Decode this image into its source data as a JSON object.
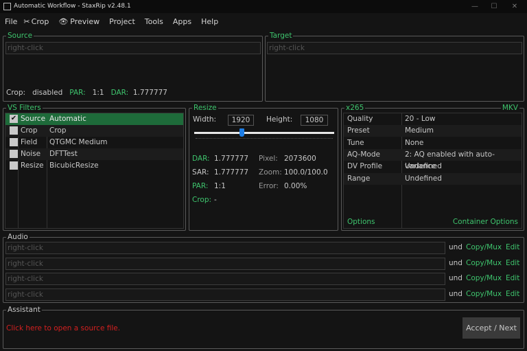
{
  "window": {
    "title": "Automatic Workflow - StaxRip v2.48.1",
    "controls": [
      "—",
      "☐",
      "✕"
    ]
  },
  "menu": {
    "file": "File",
    "crop": "Crop",
    "preview": "Preview",
    "project": "Project",
    "tools": "Tools",
    "apps": "Apps",
    "help": "Help"
  },
  "source": {
    "label": "Source",
    "placeholder": "right-click",
    "crop_label": "Crop:",
    "crop_value": "disabled",
    "par_label": "PAR:",
    "par_value": "1:1",
    "dar_label": "DAR:",
    "dar_value": "1.777777"
  },
  "target": {
    "label": "Target",
    "placeholder": "right-click"
  },
  "filters": {
    "label": "VS Filters",
    "items": [
      {
        "name": "Source",
        "value": "Automatic",
        "checked": true
      },
      {
        "name": "Crop",
        "value": "Crop",
        "checked": false
      },
      {
        "name": "Field",
        "value": "QTGMC Medium",
        "checked": false
      },
      {
        "name": "Noise",
        "value": "DFTTest",
        "checked": false
      },
      {
        "name": "Resize",
        "value": "BicubicResize",
        "checked": false
      }
    ]
  },
  "resize": {
    "label": "Resize",
    "width_label": "Width:",
    "width": "1920",
    "height_label": "Height:",
    "height": "1080",
    "slider_fraction": 0.34,
    "dar_label": "DAR:",
    "dar": "1.777777",
    "sar_label": "SAR:",
    "sar": "1.777777",
    "par_label": "PAR:",
    "par": "1:1",
    "crop_label": "Crop:",
    "crop": "-",
    "pixel_label": "Pixel:",
    "pixel": "2073600",
    "zoom_label": "Zoom:",
    "zoom": "100.0/100.0",
    "error_label": "Error:",
    "error": "0.00%"
  },
  "encoder": {
    "label": "x265",
    "container": "MKV",
    "rows": [
      {
        "k": "Quality",
        "v": "20 - Low"
      },
      {
        "k": "Preset",
        "v": "Medium"
      },
      {
        "k": "Tune",
        "v": "None"
      },
      {
        "k": "AQ-Mode",
        "v": "2: AQ enabled with auto-variance"
      },
      {
        "k": "DV Profile",
        "v": "Undefined"
      },
      {
        "k": "Range",
        "v": "Undefined"
      }
    ],
    "options": "Options",
    "container_options": "Container Options"
  },
  "audio": {
    "label": "Audio",
    "tracks": [
      {
        "placeholder": "right-click",
        "lang": "und",
        "mode": "Copy/Mux",
        "edit": "Edit"
      },
      {
        "placeholder": "right-click",
        "lang": "und",
        "mode": "Copy/Mux",
        "edit": "Edit"
      },
      {
        "placeholder": "right-click",
        "lang": "und",
        "mode": "Copy/Mux",
        "edit": "Edit"
      },
      {
        "placeholder": "right-click",
        "lang": "und",
        "mode": "Copy/Mux",
        "edit": "Edit"
      }
    ]
  },
  "assistant": {
    "label": "Assistant",
    "message": "Click here to open a source file.",
    "button": "Accept / Next"
  },
  "colors": {
    "accent": "#3ec46d",
    "selection": "#1e6b3a",
    "warning": "#d42020",
    "slider": "#1e7ee6"
  }
}
